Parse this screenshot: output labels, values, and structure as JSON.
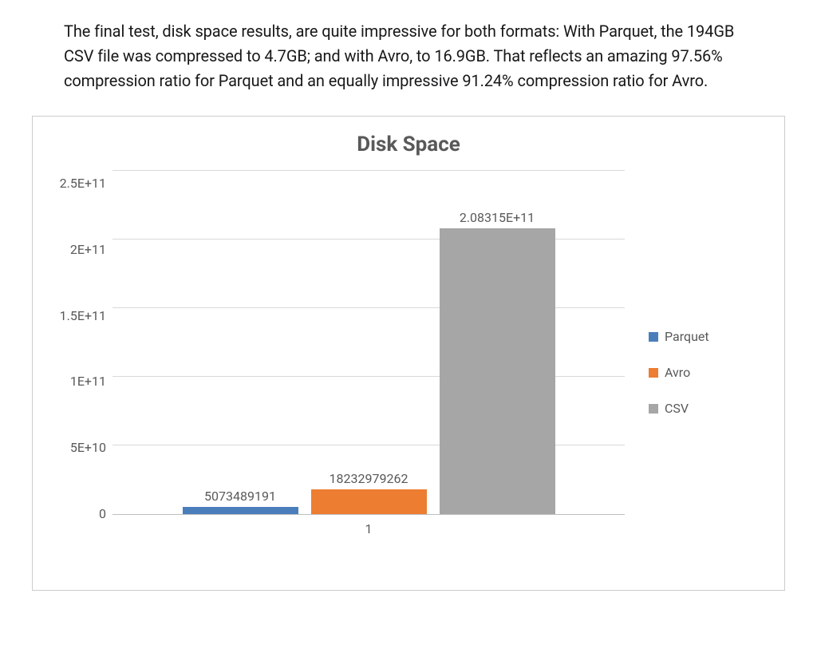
{
  "paragraph": "The final test, disk space results, are quite impressive for both formats: With Parquet, the 194GB CSV file was compressed to 4.7GB; and with Avro, to 16.9GB. That reflects an amazing 97.56% compression ratio for Parquet and an equally impressive 91.24% compression ratio for Avro.",
  "chart_data": {
    "type": "bar",
    "title": "Disk Space",
    "categories": [
      "1"
    ],
    "series": [
      {
        "name": "Parquet",
        "values": [
          5073489191
        ],
        "color": "#4a7ebb",
        "label": "5073489191"
      },
      {
        "name": "Avro",
        "values": [
          18232979262
        ],
        "color": "#ed7d31",
        "label": "18232979262"
      },
      {
        "name": "CSV",
        "values": [
          208315000000.0
        ],
        "color": "#a6a6a6",
        "label": "2.08315E+11"
      }
    ],
    "xlabel": "",
    "ylabel": "",
    "ylim": [
      0,
      250000000000.0
    ],
    "y_ticks": [
      "2.5E+11",
      "2E+11",
      "1.5E+11",
      "1E+11",
      "5E+10",
      "0"
    ],
    "x_tick_label": "1",
    "legend": [
      "Parquet",
      "Avro",
      "CSV"
    ]
  }
}
